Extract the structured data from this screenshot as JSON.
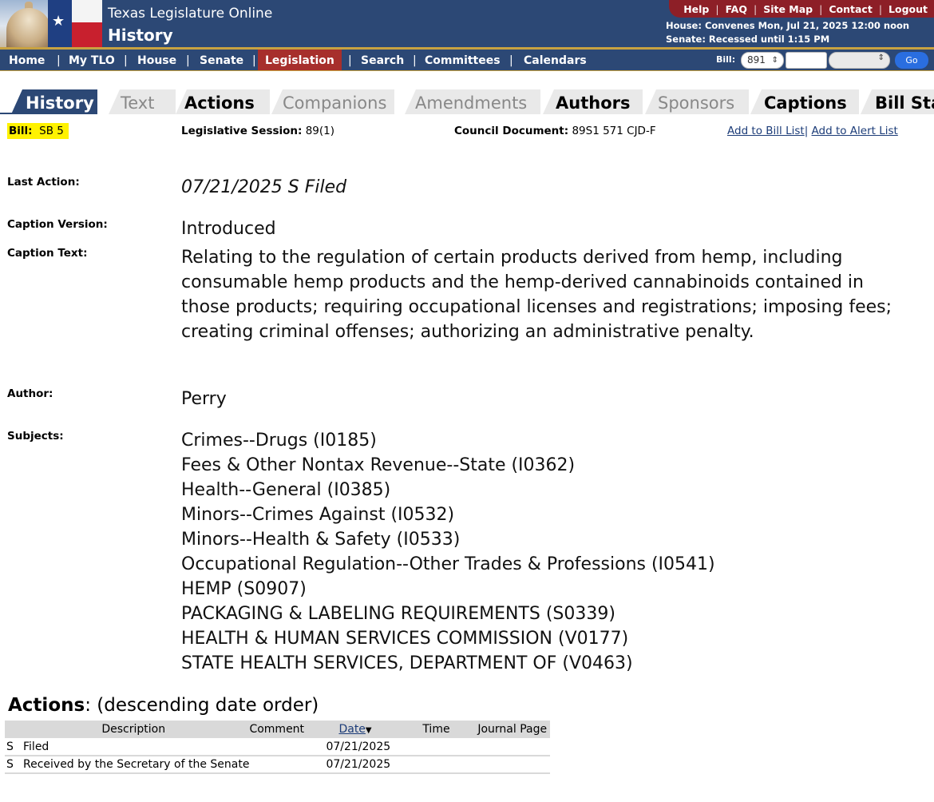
{
  "header": {
    "site_title": "Texas Legislature Online",
    "page_title": "History",
    "top_links": [
      "Help",
      "FAQ",
      "Site Map",
      "Contact",
      "Logout"
    ],
    "house_status": "House: Convenes Mon, Jul 21, 2025 12:00 noon",
    "senate_status": "Senate: Recessed until 1:15 PM"
  },
  "nav": {
    "items": [
      "Home",
      "My TLO",
      "House",
      "Senate",
      "Legislation",
      "Search",
      "Committees",
      "Calendars"
    ],
    "active": "Legislation",
    "bill_label": "Bill:",
    "bill_type": "891",
    "go_label": "Go"
  },
  "tabs": [
    "History",
    "Text",
    "Actions",
    "Companions",
    "Amendments",
    "Authors",
    "Sponsors",
    "Captions",
    "Bill Stages"
  ],
  "info": {
    "bill_label": "Bill:",
    "bill_value": "SB 5",
    "session_label": "Legislative Session:",
    "session_value": "89(1)",
    "council_label": "Council Document:",
    "council_value": "89S1 571 CJD-F",
    "add_bill_list": "Add to Bill List",
    "add_alert_list": "Add to Alert List"
  },
  "fields": {
    "last_action_label": "Last Action:",
    "last_action": "07/21/2025 S Filed",
    "caption_version_label": "Caption Version:",
    "caption_version": "Introduced",
    "caption_text_label": "Caption Text:",
    "caption_text": "Relating to the regulation of certain products derived from hemp, including consumable hemp products and the hemp-derived cannabinoids contained in those products; requiring occupational licenses and registrations; imposing fees; creating criminal offenses; authorizing an administrative penalty.",
    "author_label": "Author:",
    "author": "Perry",
    "subjects_label": "Subjects:",
    "subjects": [
      "Crimes--Drugs (I0185)",
      "Fees & Other Nontax Revenue--State (I0362)",
      "Health--General (I0385)",
      "Minors--Crimes Against (I0532)",
      "Minors--Health & Safety (I0533)",
      "Occupational Regulation--Other Trades & Professions (I0541)",
      "HEMP (S0907)",
      "PACKAGING & LABELING REQUIREMENTS (S0339)",
      "HEALTH & HUMAN SERVICES COMMISSION (V0177)",
      "STATE HEALTH SERVICES, DEPARTMENT OF (V0463)"
    ]
  },
  "actions": {
    "title": "Actions",
    "subtitle": ": (descending date order)",
    "columns": [
      "Description",
      "Comment",
      "Date",
      "Time",
      "Journal Page"
    ],
    "sort_indicator": "▼",
    "rows": [
      {
        "chamber": "S",
        "description": "Filed",
        "comment": "",
        "date": "07/21/2025",
        "time": "",
        "journal": ""
      },
      {
        "chamber": "S",
        "description": "Received by the Secretary of the Senate",
        "comment": "",
        "date": "07/21/2025",
        "time": "",
        "journal": ""
      }
    ]
  }
}
